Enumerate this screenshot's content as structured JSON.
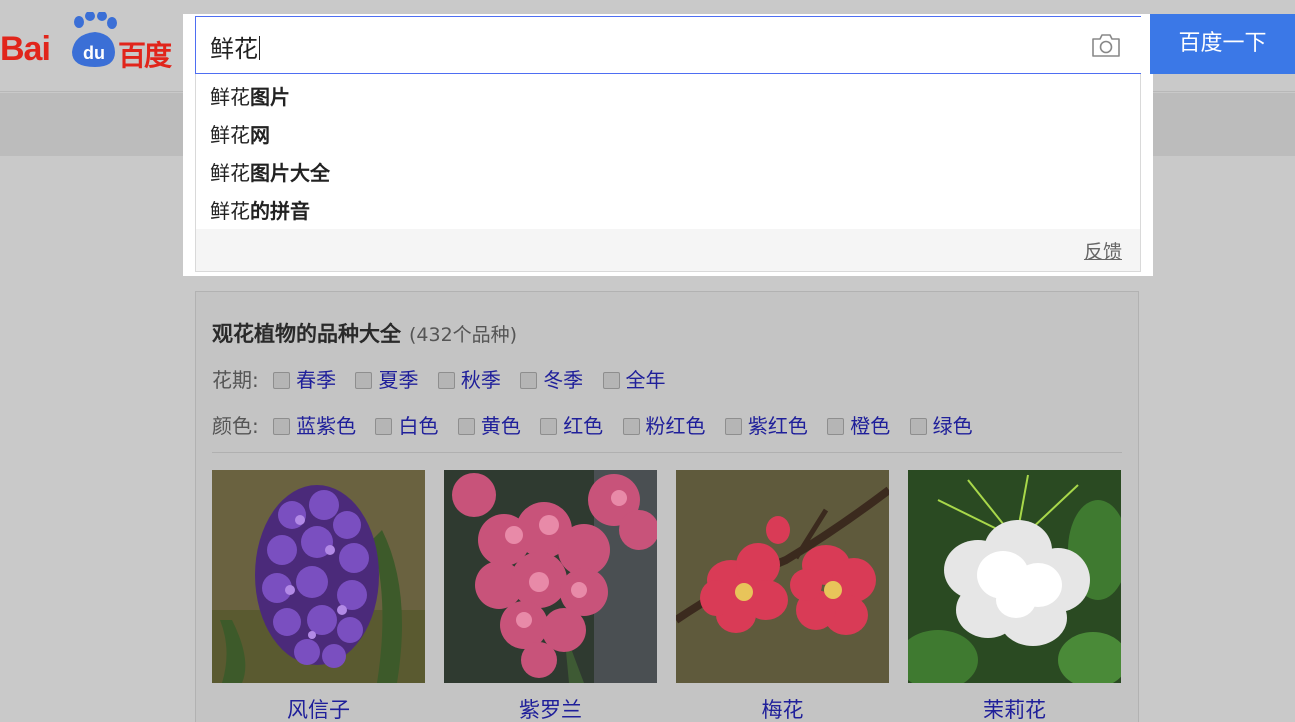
{
  "logo": {
    "text_bai": "Bai",
    "text_du": "du",
    "text_cn": "百度"
  },
  "search": {
    "query": "鲜花",
    "button_label": "百度一下",
    "suggestions": [
      {
        "prefix": "鲜花",
        "suffix": "图片"
      },
      {
        "prefix": "鲜花",
        "suffix": "网"
      },
      {
        "prefix": "鲜花",
        "suffix": "图片大全"
      },
      {
        "prefix": "鲜花",
        "suffix": "的拼音"
      }
    ],
    "feedback_label": "反馈"
  },
  "card": {
    "title": "观花植物的品种大全",
    "count": "(432个品种)",
    "season_label": "花期:",
    "seasons": [
      "春季",
      "夏季",
      "秋季",
      "冬季",
      "全年"
    ],
    "color_label": "颜色:",
    "colors": [
      "蓝紫色",
      "白色",
      "黄色",
      "红色",
      "粉红色",
      "紫红色",
      "橙色",
      "绿色"
    ],
    "flowers": [
      {
        "name": "风信子",
        "icon": "hyacinth-photo"
      },
      {
        "name": "紫罗兰",
        "icon": "violet-photo"
      },
      {
        "name": "梅花",
        "icon": "plum-blossom-photo"
      },
      {
        "name": "茉莉花",
        "icon": "jasmine-photo"
      }
    ]
  },
  "colors": {
    "brand_red": "#e1251b",
    "brand_blue": "#3b78e7",
    "link": "#1f1f9a"
  }
}
